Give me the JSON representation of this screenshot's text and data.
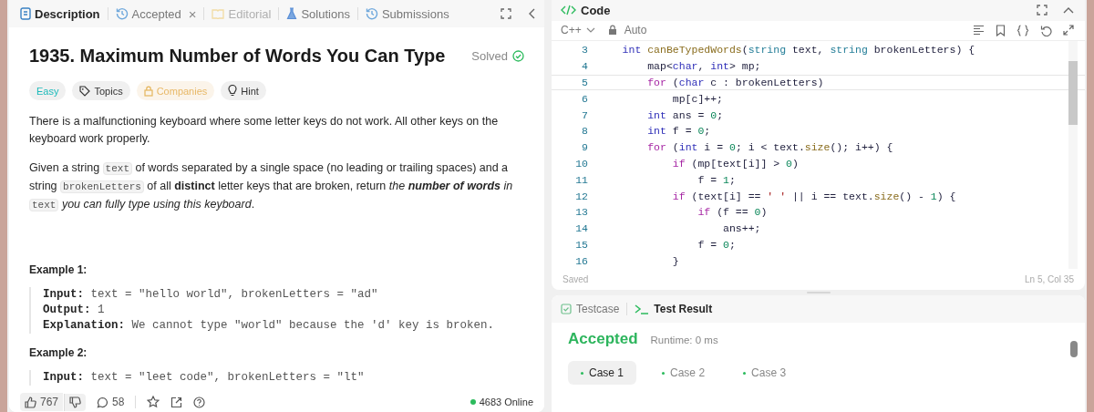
{
  "description_panel": {
    "tabs": [
      {
        "label": "Description",
        "selected": true,
        "disabled": false,
        "kind": "doc"
      },
      {
        "label": "Accepted",
        "selected": false,
        "disabled": false,
        "kind": "history",
        "close": "×"
      },
      {
        "label": "Editorial",
        "selected": false,
        "disabled": true,
        "kind": "book"
      },
      {
        "label": "Solutions",
        "selected": false,
        "disabled": false,
        "kind": "flask"
      },
      {
        "label": "Submissions",
        "selected": false,
        "disabled": false,
        "kind": "history"
      }
    ],
    "title": "1935. Maximum Number of Words You Can Type",
    "status": "Solved",
    "tags": [
      {
        "label": "Easy",
        "kind": "difficulty"
      },
      {
        "label": "Topics",
        "kind": "topics"
      },
      {
        "label": "Companies",
        "kind": "locked"
      },
      {
        "label": "Hint",
        "kind": "hint"
      }
    ],
    "paragraphs": [
      [
        {
          "kind": "t",
          "text": "There is a malfunctioning keyboard where some letter keys do not work. All other keys on the keyboard work properly."
        }
      ],
      [
        {
          "kind": "t",
          "text": "Given a string "
        },
        {
          "kind": "code",
          "text": "text"
        },
        {
          "kind": "t",
          "text": " of words separated by a single space (no leading or trailing spaces) and a string "
        },
        {
          "kind": "code",
          "text": "brokenLetters"
        },
        {
          "kind": "t",
          "text": " of all "
        },
        {
          "kind": "b",
          "text": "distinct"
        },
        {
          "kind": "t",
          "text": " letter keys that are broken, return "
        },
        {
          "kind": "i",
          "text": "the "
        },
        {
          "kind": "bi",
          "text": "number of words"
        },
        {
          "kind": "i",
          "text": " in "
        },
        {
          "kind": "code",
          "text": "text"
        },
        {
          "kind": "i",
          "text": " you can fully type using this keyboard"
        },
        {
          "kind": "t",
          "text": "."
        }
      ]
    ],
    "examples": [
      {
        "title": "Example 1:",
        "lines": [
          {
            "label": "Input:",
            "value": "text = \"hello world\", brokenLetters = \"ad\""
          },
          {
            "label": "Output:",
            "value": "1"
          },
          {
            "label": "Explanation:",
            "value": "We cannot type \"world\" because the 'd' key is broken."
          }
        ]
      },
      {
        "title": "Example 2:",
        "lines": [
          {
            "label": "Input:",
            "value": "text = \"leet code\", brokenLetters = \"lt\""
          }
        ]
      }
    ],
    "footer": {
      "likes": "767",
      "comments": "58",
      "online": "4683 Online"
    }
  },
  "code_panel": {
    "title": "Code",
    "language": "C++",
    "mode": "Auto",
    "lines": [
      {
        "number": "3",
        "current": false,
        "tokens": [
          {
            "kind": "type",
            "text": "    int"
          },
          {
            "kind": "fn",
            "text": " canBeTypedWords"
          },
          {
            "kind": "p",
            "text": "("
          },
          {
            "kind": "cls",
            "text": "string"
          },
          {
            "kind": "p",
            "text": " text, "
          },
          {
            "kind": "cls",
            "text": "string"
          },
          {
            "kind": "p",
            "text": " brokenLetters) {"
          }
        ]
      },
      {
        "number": "4",
        "current": false,
        "tokens": [
          {
            "kind": "p",
            "text": "        map<"
          },
          {
            "kind": "type",
            "text": "char"
          },
          {
            "kind": "p",
            "text": ", "
          },
          {
            "kind": "type",
            "text": "int"
          },
          {
            "kind": "p",
            "text": "> mp;"
          }
        ]
      },
      {
        "number": "5",
        "current": true,
        "tokens": [
          {
            "kind": "ctrl",
            "text": "        for"
          },
          {
            "kind": "p",
            "text": " ("
          },
          {
            "kind": "type",
            "text": "char"
          },
          {
            "kind": "p",
            "text": " c : brokenLetters)"
          }
        ]
      },
      {
        "number": "6",
        "current": false,
        "tokens": [
          {
            "kind": "p",
            "text": "            mp[c]++;"
          }
        ]
      },
      {
        "number": "7",
        "current": false,
        "tokens": [
          {
            "kind": "type",
            "text": "        int"
          },
          {
            "kind": "p",
            "text": " ans = "
          },
          {
            "kind": "num",
            "text": "0"
          },
          {
            "kind": "p",
            "text": ";"
          }
        ]
      },
      {
        "number": "8",
        "current": false,
        "tokens": [
          {
            "kind": "type",
            "text": "        int"
          },
          {
            "kind": "p",
            "text": " f = "
          },
          {
            "kind": "num",
            "text": "0"
          },
          {
            "kind": "p",
            "text": ";"
          }
        ]
      },
      {
        "number": "9",
        "current": false,
        "tokens": [
          {
            "kind": "ctrl",
            "text": "        for"
          },
          {
            "kind": "p",
            "text": " ("
          },
          {
            "kind": "type",
            "text": "int"
          },
          {
            "kind": "p",
            "text": " i = "
          },
          {
            "kind": "num",
            "text": "0"
          },
          {
            "kind": "p",
            "text": "; i < text."
          },
          {
            "kind": "fn",
            "text": "size"
          },
          {
            "kind": "p",
            "text": "(); i++) {"
          }
        ]
      },
      {
        "number": "10",
        "current": false,
        "tokens": [
          {
            "kind": "ctrl",
            "text": "            if"
          },
          {
            "kind": "p",
            "text": " (mp[text[i]] > "
          },
          {
            "kind": "num",
            "text": "0"
          },
          {
            "kind": "p",
            "text": ")"
          }
        ]
      },
      {
        "number": "11",
        "current": false,
        "tokens": [
          {
            "kind": "p",
            "text": "                f = "
          },
          {
            "kind": "num",
            "text": "1"
          },
          {
            "kind": "p",
            "text": ";"
          }
        ]
      },
      {
        "number": "12",
        "current": false,
        "tokens": [
          {
            "kind": "ctrl",
            "text": "            if"
          },
          {
            "kind": "p",
            "text": " (text[i] == "
          },
          {
            "kind": "str",
            "text": "' '"
          },
          {
            "kind": "p",
            "text": " || i == text."
          },
          {
            "kind": "fn",
            "text": "size"
          },
          {
            "kind": "p",
            "text": "() - "
          },
          {
            "kind": "num",
            "text": "1"
          },
          {
            "kind": "p",
            "text": ") {"
          }
        ]
      },
      {
        "number": "13",
        "current": false,
        "tokens": [
          {
            "kind": "ctrl",
            "text": "                if"
          },
          {
            "kind": "p",
            "text": " (f == "
          },
          {
            "kind": "num",
            "text": "0"
          },
          {
            "kind": "p",
            "text": ")"
          }
        ]
      },
      {
        "number": "14",
        "current": false,
        "tokens": [
          {
            "kind": "p",
            "text": "                    ans++;"
          }
        ]
      },
      {
        "number": "15",
        "current": false,
        "tokens": [
          {
            "kind": "p",
            "text": "                f = "
          },
          {
            "kind": "num",
            "text": "0"
          },
          {
            "kind": "p",
            "text": ";"
          }
        ]
      },
      {
        "number": "16",
        "current": false,
        "tokens": [
          {
            "kind": "p",
            "text": "            }"
          }
        ]
      }
    ],
    "save_status": "Saved",
    "cursor": "Ln 5, Col 35"
  },
  "result_panel": {
    "tabs": [
      {
        "label": "Testcase",
        "selected": false,
        "kind": "check"
      },
      {
        "label": "Test Result",
        "selected": true,
        "kind": "terminal"
      }
    ],
    "verdict": "Accepted",
    "runtime": "Runtime: 0 ms",
    "cases": [
      {
        "label": "Case 1",
        "selected": true
      },
      {
        "label": "Case 2",
        "selected": false
      },
      {
        "label": "Case 3",
        "selected": false
      }
    ]
  }
}
